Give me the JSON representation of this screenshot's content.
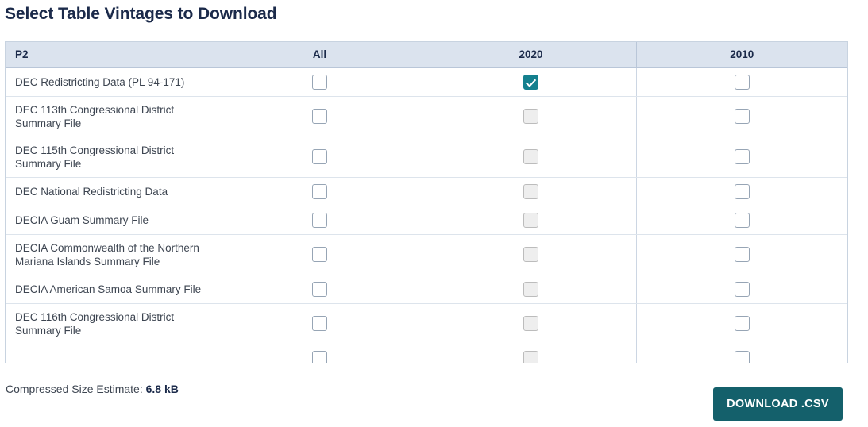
{
  "page_title": "Select Table Vintages to Download",
  "colors": {
    "title": "#1b2a4a",
    "header_bg": "#dbe3ee",
    "checked_accent": "#14808e",
    "download_button_bg": "#14606b"
  },
  "table": {
    "columns": [
      {
        "key": "label",
        "label": "P2"
      },
      {
        "key": "all",
        "label": "All"
      },
      {
        "key": "2020",
        "label": "2020"
      },
      {
        "key": "2010",
        "label": "2010"
      }
    ],
    "rows": [
      {
        "label": "DEC Redistricting Data (PL 94-171)",
        "all": "unchecked",
        "2020": "checked",
        "2010": "unchecked"
      },
      {
        "label": "DEC 113th Congressional District Summary File",
        "all": "unchecked",
        "2020": "disabled",
        "2010": "unchecked"
      },
      {
        "label": "DEC 115th Congressional District Summary File",
        "all": "unchecked",
        "2020": "disabled",
        "2010": "unchecked"
      },
      {
        "label": "DEC National Redistricting Data",
        "all": "unchecked",
        "2020": "disabled",
        "2010": "unchecked"
      },
      {
        "label": "DECIA Guam Summary File",
        "all": "unchecked",
        "2020": "disabled",
        "2010": "unchecked"
      },
      {
        "label": "DECIA Commonwealth of the Northern Mariana Islands Summary File",
        "all": "unchecked",
        "2020": "disabled",
        "2010": "unchecked"
      },
      {
        "label": "DECIA American Samoa Summary File",
        "all": "unchecked",
        "2020": "disabled",
        "2010": "unchecked"
      },
      {
        "label": "DEC 116th Congressional District Summary File",
        "all": "unchecked",
        "2020": "disabled",
        "2010": "unchecked"
      },
      {
        "label": "",
        "all": "unchecked",
        "2020": "disabled",
        "2010": "unchecked"
      }
    ]
  },
  "footer": {
    "size_label": "Compressed Size Estimate:",
    "size_value": "6.8 kB",
    "download_label": "DOWNLOAD .CSV"
  }
}
